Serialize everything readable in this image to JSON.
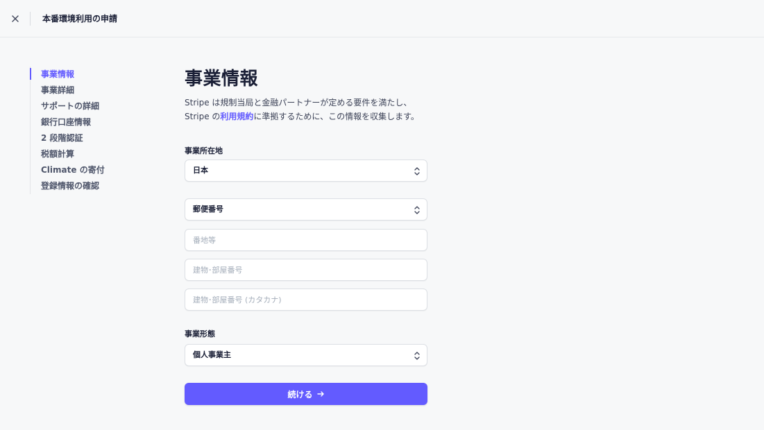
{
  "topbar": {
    "close_icon": "close-icon",
    "title": "本番環境利用の申請"
  },
  "sidenav": {
    "items": [
      {
        "label": "事業情報",
        "active": true
      },
      {
        "label": "事業詳細",
        "active": false
      },
      {
        "label": "サポートの詳細",
        "active": false
      },
      {
        "label": "銀行口座情報",
        "active": false
      },
      {
        "label": "2 段階認証",
        "active": false
      },
      {
        "label": "税額計算",
        "active": false
      },
      {
        "label": "Climate の寄付",
        "active": false
      },
      {
        "label": "登録情報の確認",
        "active": false
      }
    ]
  },
  "main": {
    "title": "事業情報",
    "desc_part1": "Stripe は規制当局と金融パートナーが定める要件を満たし、Stripe の",
    "desc_link": "利用規約",
    "desc_part2": "に準拠するために、この情報を収集します。",
    "location_label": "事業所在地",
    "country_value": "日本",
    "postal_value": "郵便番号",
    "address_placeholder": "番地等",
    "building_placeholder": "建物･部屋番号",
    "building_kana_placeholder": "建物･部屋番号 (カタカナ)",
    "business_type_label": "事業形態",
    "business_type_value": "個人事業主",
    "continue_label": "続ける",
    "continue_icon": "arrow-right-icon"
  },
  "colors": {
    "accent": "#635bff",
    "text": "#1a1f36",
    "muted": "#4f566b",
    "background": "#f7f8f9",
    "placeholder": "#a3acb9"
  }
}
